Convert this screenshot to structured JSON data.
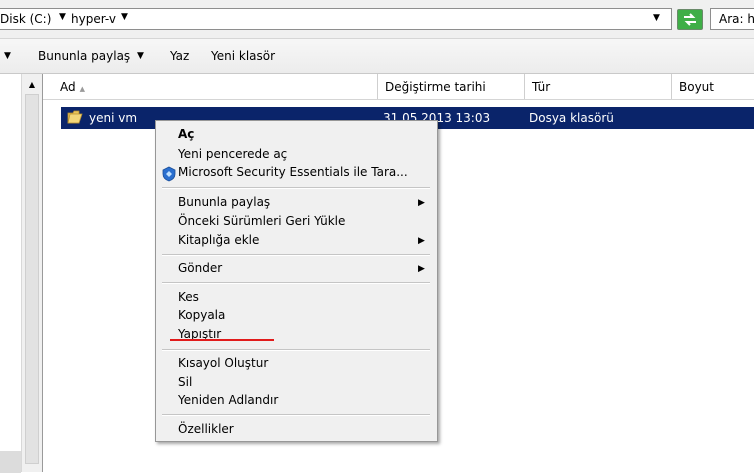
{
  "address_bar": {
    "crumbs": [
      "Disk (C:)",
      "hyper-v"
    ],
    "search_label": "Ara: h"
  },
  "toolbar": {
    "share_label": "Bununla paylaş",
    "print_label": "Yaz",
    "new_folder_label": "Yeni klasör"
  },
  "columns": [
    "Ad",
    "Değiştirme tarihi",
    "Tür",
    "Boyut"
  ],
  "file_row": {
    "name": "yeni vm",
    "modified": "31.05.2013 13:03",
    "type": "Dosya klasörü"
  },
  "context_menu": {
    "groups": [
      [
        "Aç",
        "Yeni pencerede aç",
        "Microsoft Security Essentials ile Tara..."
      ],
      [
        "Bununla paylaş",
        "Önceki Sürümleri Geri Yükle",
        "Kitaplığa ekle"
      ],
      [
        "Gönder"
      ],
      [
        "Kes",
        "Kopyala",
        "Yapıştır"
      ],
      [
        "Kısayol Oluştur",
        "Sil",
        "Yeniden Adlandır"
      ],
      [
        "Özellikler"
      ]
    ]
  },
  "colors": {
    "selection": "#0a246a",
    "annotation_underline": "#e11b1b",
    "refresh_button": "#3fae47"
  }
}
